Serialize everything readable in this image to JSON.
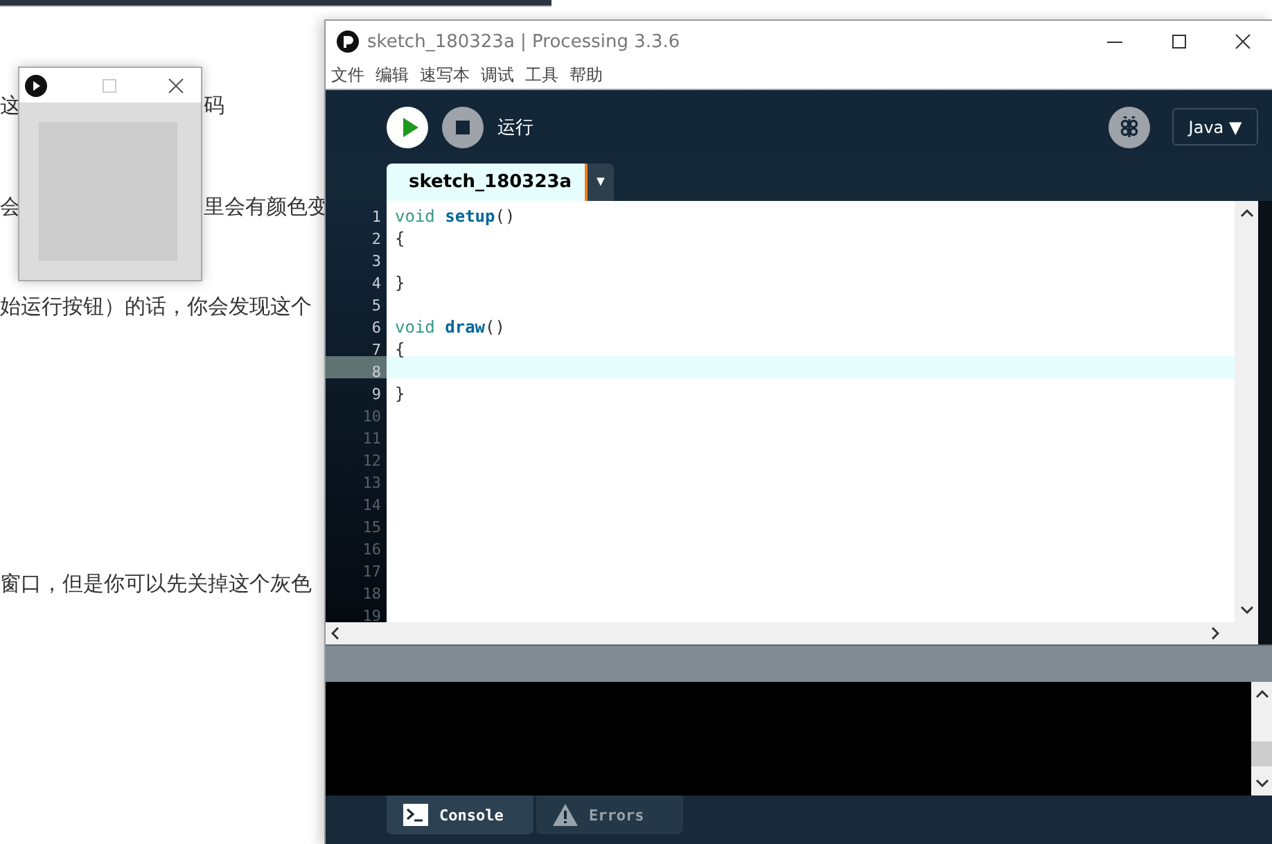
{
  "background_page": {
    "lines": [
      {
        "segments": [
          "这",
          "码"
        ]
      },
      {
        "segments": [
          "会",
          "里会有颜色变"
        ]
      },
      {
        "segments": [
          "始运行按钮）的话，你会发现这个"
        ]
      },
      {
        "segments": [
          "窗口，但是你可以先关掉这个灰色"
        ]
      }
    ]
  },
  "window": {
    "title": "sketch_180323a | Processing 3.3.6"
  },
  "menu": [
    "文件",
    "编辑",
    "速写本",
    "调试",
    "工具",
    "帮助"
  ],
  "toolbar": {
    "run_label": "运行",
    "mode": "Java",
    "mode_caret": "▼"
  },
  "tabs": [
    {
      "label": "sketch_180323a",
      "selected": true
    }
  ],
  "tab_menu_caret": "▼",
  "editor": {
    "lines": [
      {
        "number": "1",
        "dim": false,
        "selected": false,
        "tokens": [
          {
            "kind": "keyword",
            "text": "void "
          },
          {
            "kind": "function",
            "text": "setup"
          },
          {
            "kind": "plain",
            "text": "()"
          }
        ]
      },
      {
        "number": "2",
        "dim": false,
        "selected": false,
        "tokens": [
          {
            "kind": "plain",
            "text": "{"
          }
        ]
      },
      {
        "number": "3",
        "dim": false,
        "selected": false
      },
      {
        "number": "4",
        "dim": false,
        "selected": false,
        "tokens": [
          {
            "kind": "plain",
            "text": "}"
          }
        ]
      },
      {
        "number": "5",
        "dim": false,
        "selected": false
      },
      {
        "number": "6",
        "dim": false,
        "selected": false,
        "tokens": [
          {
            "kind": "keyword",
            "text": "void "
          },
          {
            "kind": "function",
            "text": "draw"
          },
          {
            "kind": "plain",
            "text": "()"
          }
        ]
      },
      {
        "number": "7",
        "dim": false,
        "selected": false,
        "tokens": [
          {
            "kind": "plain",
            "text": "{"
          }
        ]
      },
      {
        "number": "8",
        "dim": false,
        "selected": true
      },
      {
        "number": "9",
        "dim": false,
        "selected": false,
        "tokens": [
          {
            "kind": "plain",
            "text": "}"
          }
        ]
      },
      {
        "number": "10",
        "dim": true,
        "selected": false
      },
      {
        "number": "11",
        "dim": true,
        "selected": false
      },
      {
        "number": "12",
        "dim": true,
        "selected": false
      },
      {
        "number": "13",
        "dim": true,
        "selected": false
      },
      {
        "number": "14",
        "dim": true,
        "selected": false
      },
      {
        "number": "15",
        "dim": true,
        "selected": false
      },
      {
        "number": "16",
        "dim": true,
        "selected": false
      },
      {
        "number": "17",
        "dim": true,
        "selected": false
      },
      {
        "number": "18",
        "dim": true,
        "selected": false
      },
      {
        "number": "19",
        "dim": true,
        "selected": false
      }
    ]
  },
  "console_tabs": [
    {
      "kind": "console",
      "label": "Console",
      "selected": true
    },
    {
      "kind": "errors",
      "label": "Errors",
      "selected": false
    }
  ]
}
